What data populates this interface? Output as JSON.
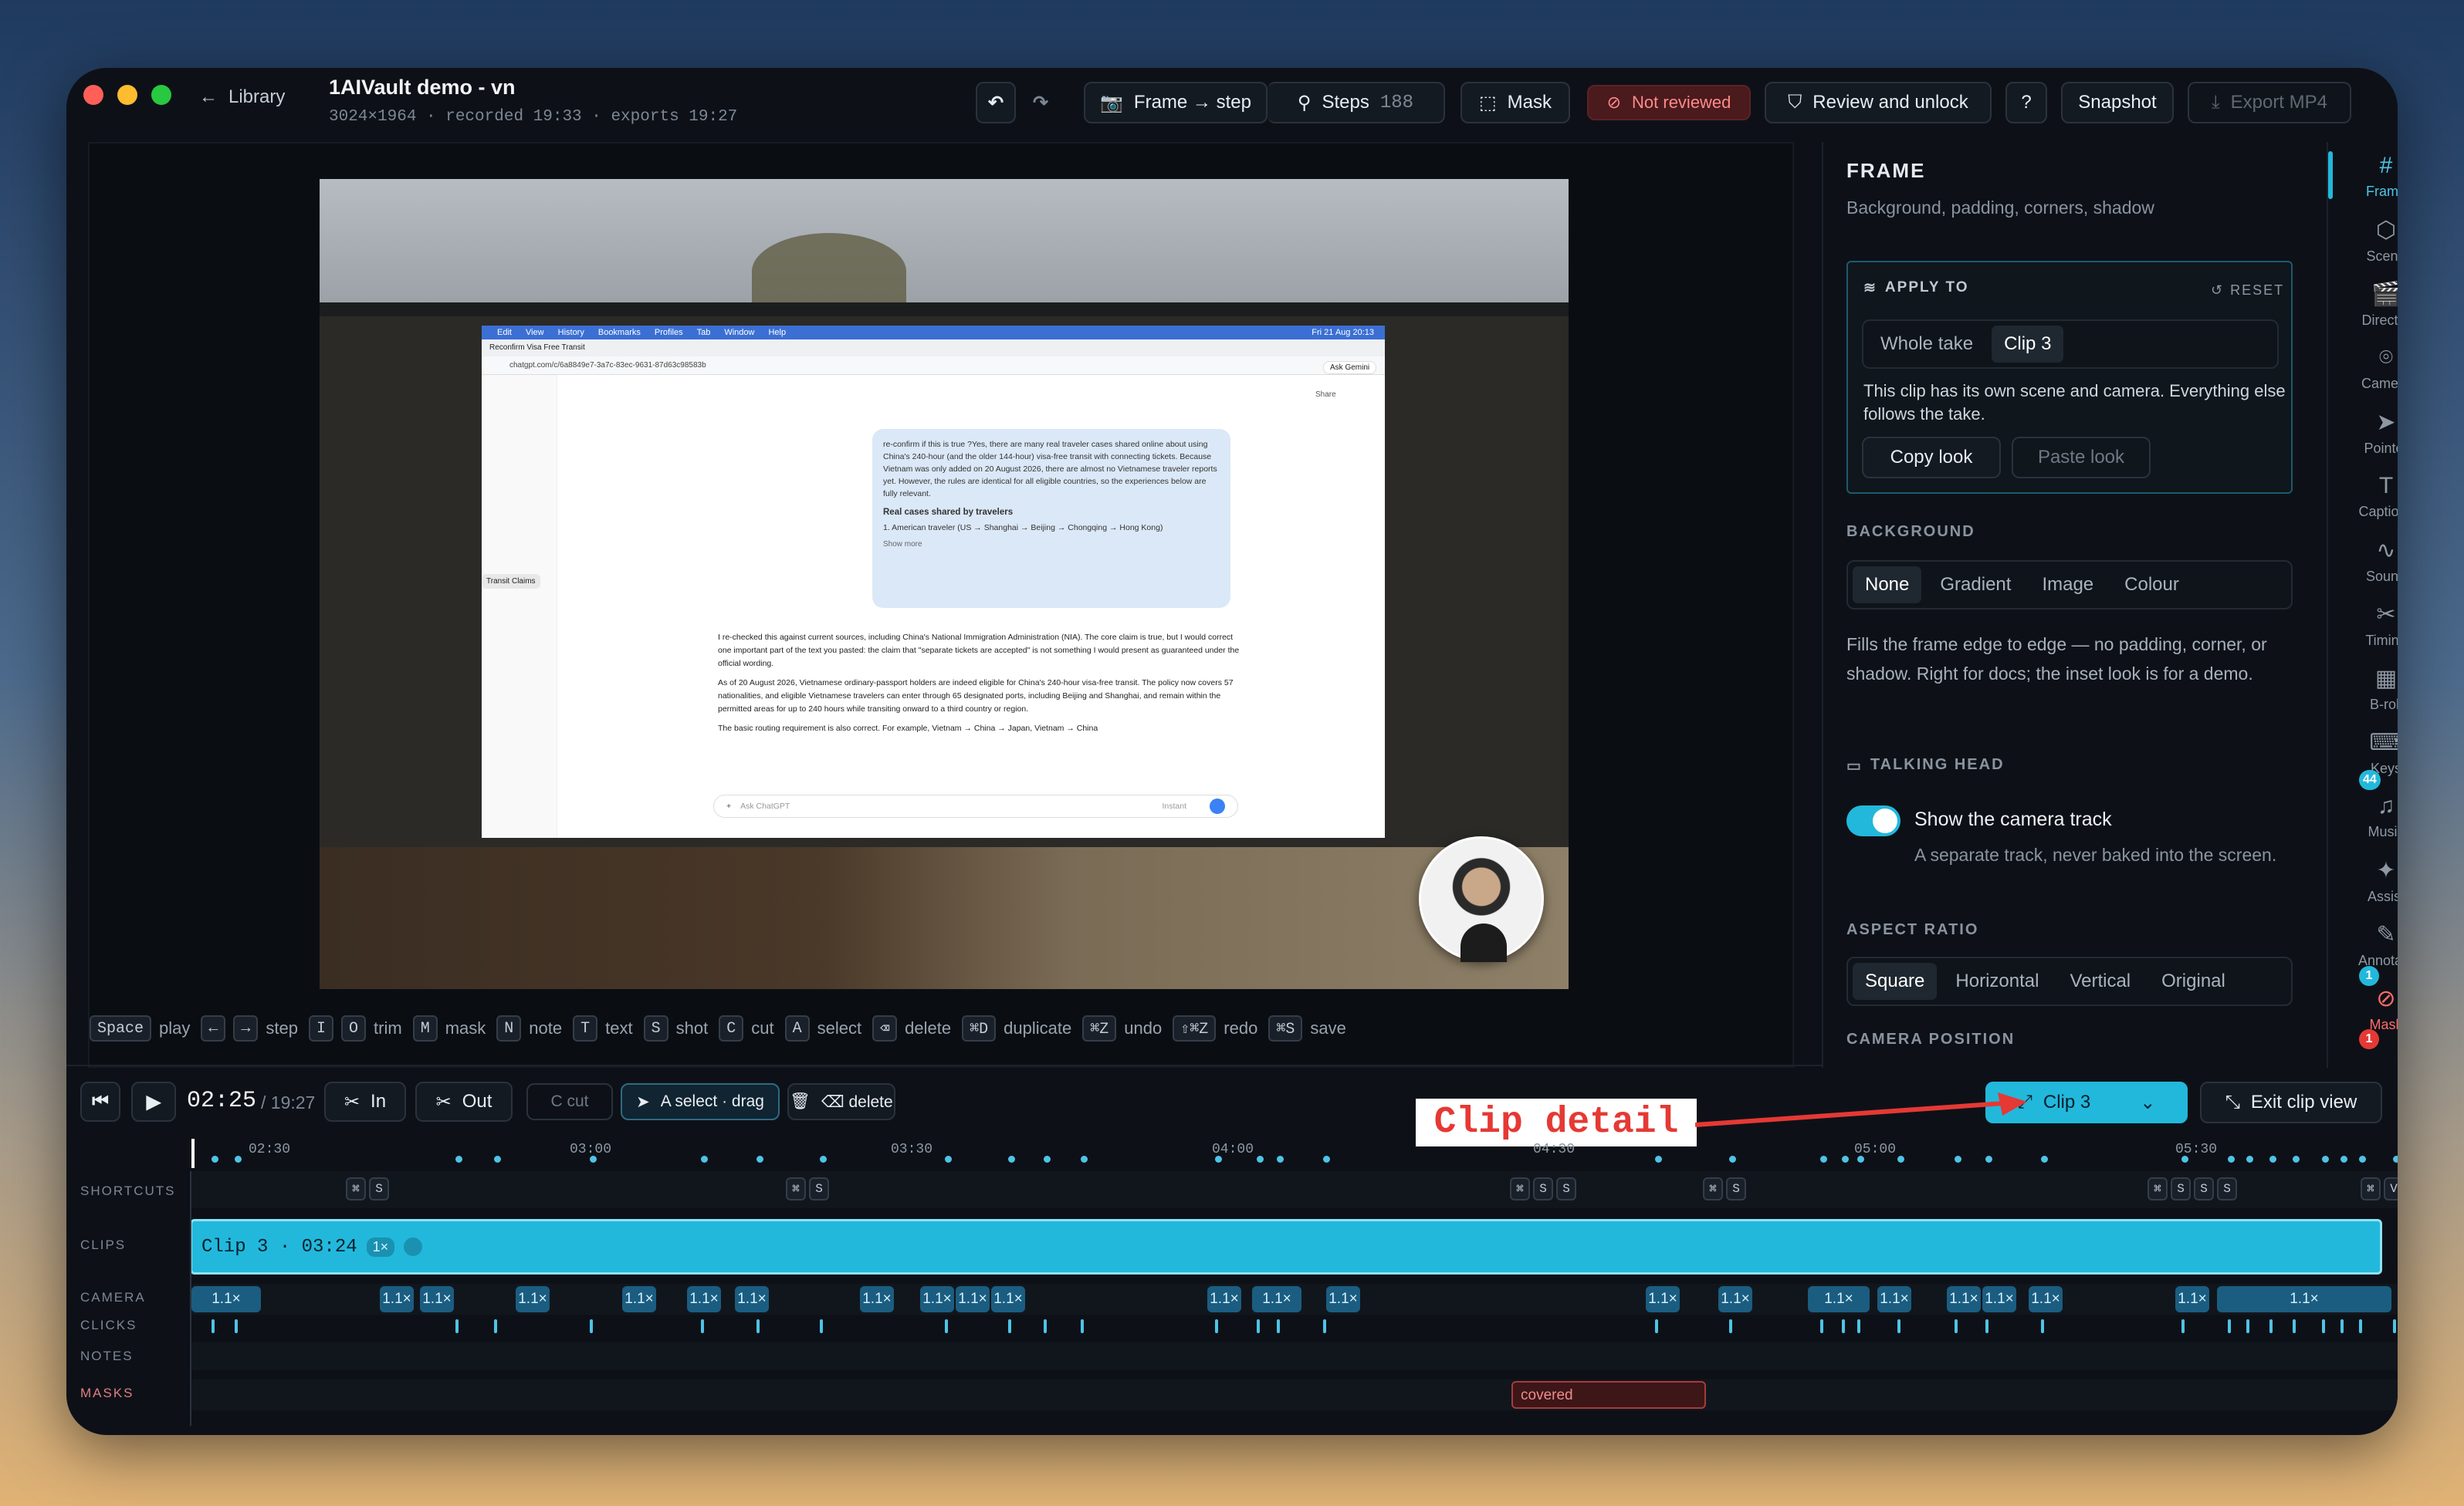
{
  "window": {
    "back_label": "Library",
    "project_title": "1AIVault demo - vn",
    "project_meta": "3024×1964 · recorded 19:33 · exports 19:27"
  },
  "toolbar": {
    "frame_step": "Frame → step",
    "steps_label": "Steps",
    "steps_count": "188",
    "mask": "Mask",
    "not_reviewed": "Not reviewed",
    "review_unlock": "Review and unlock",
    "help": "?",
    "snapshot": "Snapshot",
    "export": "Export MP4"
  },
  "preview": {
    "chat_bubble_1": "re-confirm if this is true ?Yes, there are many real traveler cases shared online about using China's 240-hour (and the older 144-hour) visa-free transit with connecting tickets. Because Vietnam was only added on 20 August 2026, there are almost no Vietnamese traveler reports yet. However, the rules are identical for all eligible countries, so the experiences below are fully relevant.",
    "chat_bubble_head": "Real cases shared by travelers",
    "chat_bubble_item": "1. American traveler (US → Shanghai → Beijing → Chongqing → Hong Kong)",
    "show_more": "Show more",
    "answer_1": "I re-checked this against current sources, including China's National Immigration Administration (NIA). The core claim is true, but I would correct one important part of the text you pasted: the claim that \"separate tickets are accepted\" is not something I would present as guaranteed under the official wording.",
    "answer_2": "As of 20 August 2026, Vietnamese ordinary-passport holders are indeed eligible for China's 240-hour visa-free transit. The policy now covers 57 nationalities, and eligible Vietnamese travelers can enter through 65 designated ports, including Beijing and Shanghai, and remain within the permitted areas for up to 240 hours while transiting onward to a third country or region.",
    "answer_3": "The basic routing requirement is also correct. For example, Vietnam → China → Japan, Vietnam → China",
    "url": "chatgpt.com/c/6a8849e7-3a7c-83ec-9631-87d63c98583b",
    "tab": "Reconfirm Visa Free Transit",
    "sidebar_item": "Transit Claims",
    "ask_placeholder": "Ask ChatGPT",
    "menu": [
      "Edit",
      "View",
      "History",
      "Bookmarks",
      "Profiles",
      "Tab",
      "Window",
      "Help"
    ],
    "clock": "Fri 21 Aug 20:13",
    "share": "Share",
    "ask_gemini": "Ask Gemini",
    "instant": "Instant"
  },
  "shortcuts": [
    {
      "key": "Space",
      "label": "play"
    },
    {
      "key": "←",
      "label": ""
    },
    {
      "key": "→",
      "label": "step"
    },
    {
      "key": "I",
      "label": ""
    },
    {
      "key": "O",
      "label": "trim"
    },
    {
      "key": "M",
      "label": "mask"
    },
    {
      "key": "N",
      "label": "note"
    },
    {
      "key": "T",
      "label": "text"
    },
    {
      "key": "S",
      "label": "shot"
    },
    {
      "key": "C",
      "label": "cut"
    },
    {
      "key": "A",
      "label": "select"
    },
    {
      "key": "⌫",
      "label": "delete"
    },
    {
      "key": "⌘D",
      "label": "duplicate"
    },
    {
      "key": "⌘Z",
      "label": "undo"
    },
    {
      "key": "⇧⌘Z",
      "label": "redo"
    },
    {
      "key": "⌘S",
      "label": "save"
    }
  ],
  "transport": {
    "time_current": "02:25",
    "time_total": "/ 19:27",
    "in_label": "In",
    "out_label": "Out",
    "c_cut": "C cut",
    "a_select": "A select · drag",
    "delete_label": "⌫ delete",
    "clip_select": "Clip 3",
    "exit_clip": "Exit clip view"
  },
  "annotation": {
    "text": "Clip detail"
  },
  "ruler": [
    "02:30",
    "03:00",
    "03:30",
    "04:00",
    "04:30",
    "05:00",
    "05:30"
  ],
  "tracks": {
    "shortcuts": "SHORTCUTS",
    "clips": "CLIPS",
    "camera": "CAMERA",
    "clicks": "CLICKS",
    "notes": "NOTES",
    "masks": "MASKS"
  },
  "clip_bar": {
    "label": "Clip 3 · 03:24",
    "speed": "1×"
  },
  "camera_chip": "1.1×",
  "mask_chip": "covered",
  "panel": {
    "title": "FRAME",
    "subtitle": "Background, padding, corners, shadow",
    "apply_to": "APPLY TO",
    "reset": "RESET",
    "apply_options": [
      "Whole take",
      "Clip 3"
    ],
    "apply_note": "This clip has its own scene and camera. Everything else follows the take.",
    "copy_look": "Copy look",
    "paste_look": "Paste look",
    "background_head": "BACKGROUND",
    "background_options": [
      "None",
      "Gradient",
      "Image",
      "Colour"
    ],
    "background_note": "Fills the frame edge to edge — no padding, corner, or shadow. Right for docs; the inset look is for a demo.",
    "talking_head": "TALKING HEAD",
    "camera_toggle_label": "Show the camera track",
    "camera_toggle_note": "A separate track, never baked into the screen.",
    "camera_toggle_on": true,
    "aspect_head": "ASPECT RATIO",
    "aspect_options": [
      "Square",
      "Horizontal",
      "Vertical",
      "Original"
    ],
    "camera_pos_head": "CAMERA POSITION"
  },
  "rail": [
    {
      "label": "Frame",
      "icon": "frame-icon"
    },
    {
      "label": "Scene",
      "icon": "cube-icon"
    },
    {
      "label": "Director",
      "icon": "clapper-icon"
    },
    {
      "label": "Camera",
      "icon": "camera-focus-icon"
    },
    {
      "label": "Pointer",
      "icon": "pointer-icon"
    },
    {
      "label": "Captions",
      "icon": "text-icon"
    },
    {
      "label": "Sound",
      "icon": "waveform-icon"
    },
    {
      "label": "Timing",
      "icon": "scissors-icon"
    },
    {
      "label": "B-roll",
      "icon": "film-icon"
    },
    {
      "label": "Keys",
      "icon": "keyboard-icon"
    },
    {
      "label": "Music",
      "icon": "music-icon"
    },
    {
      "label": "Assist",
      "icon": "sparkle-icon"
    },
    {
      "label": "Annotate",
      "icon": "pen-icon"
    },
    {
      "label": "Mask",
      "icon": "eye-off-icon"
    }
  ],
  "rail_badges": {
    "keys": "44",
    "annotate": "1",
    "mask": "1"
  },
  "colors": {
    "accent": "#22b8dc",
    "annotation_red": "#e53935",
    "warning_bg": "#4a1a1d"
  }
}
